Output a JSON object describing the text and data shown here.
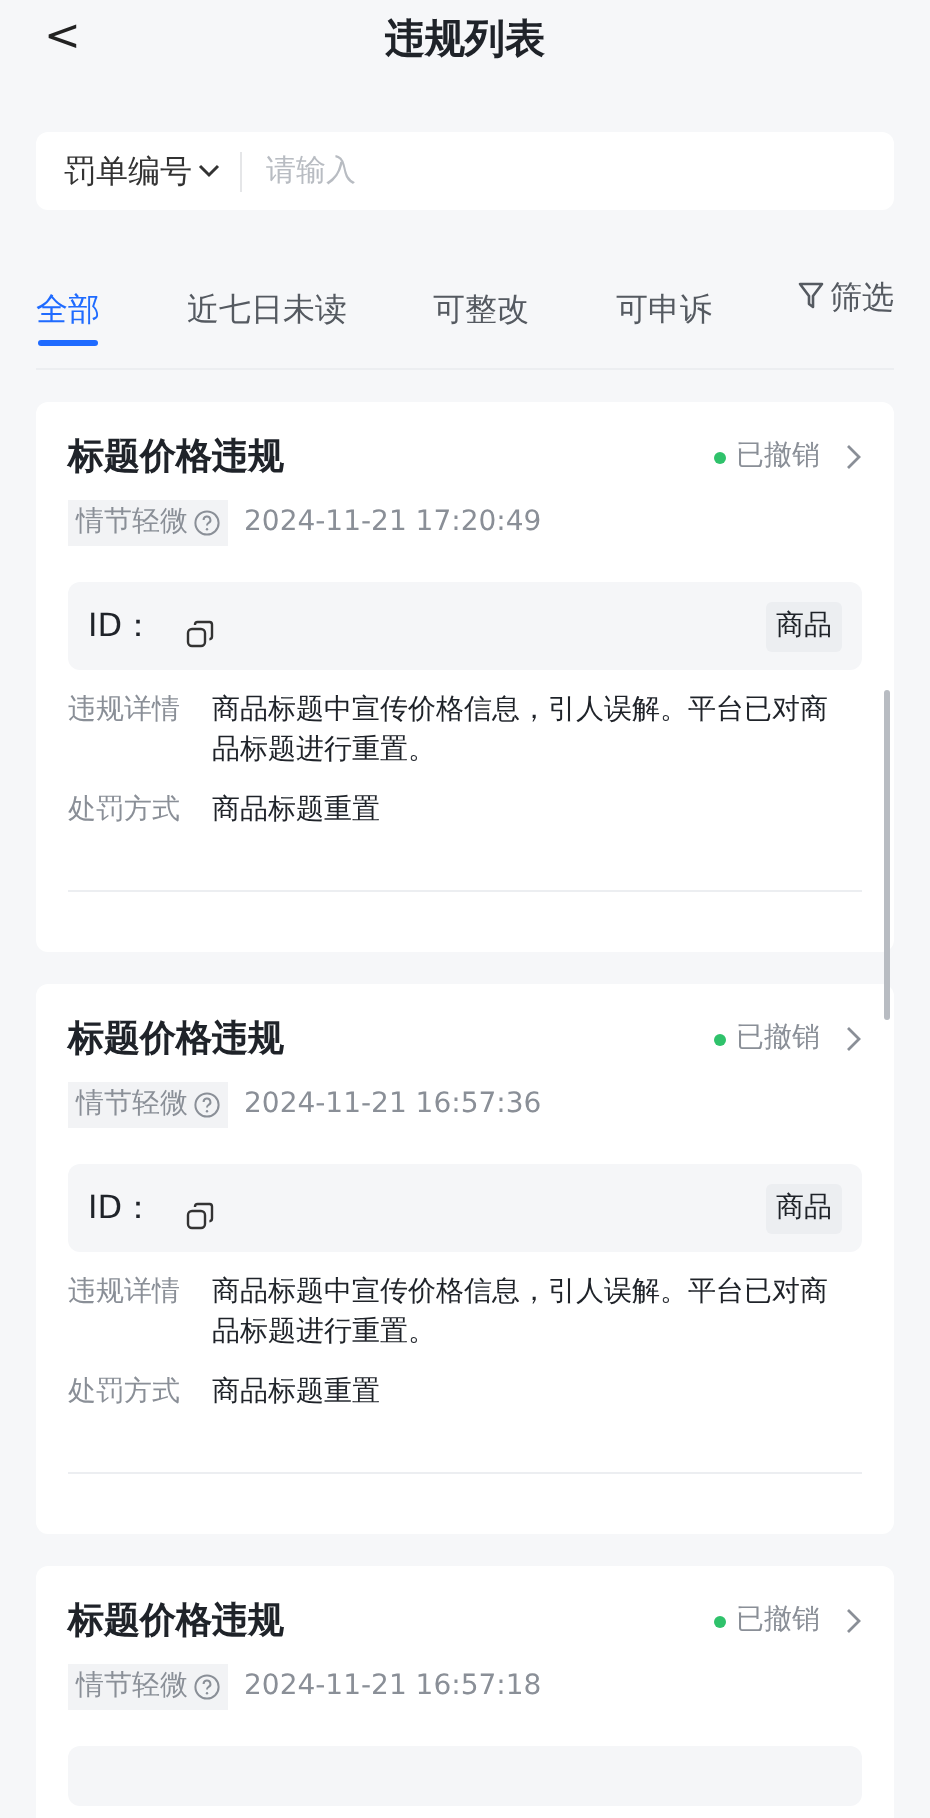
{
  "header": {
    "back": "<",
    "title": "违规列表"
  },
  "search": {
    "field_type": "罚单编号",
    "placeholder": "请输入"
  },
  "tabs": [
    {
      "label": "全部",
      "selected": true
    },
    {
      "label": "近七日未读",
      "selected": false
    },
    {
      "label": "可整改",
      "selected": false
    },
    {
      "label": "可申诉",
      "selected": false
    }
  ],
  "filter": "筛选",
  "records": [
    {
      "title": "标题价格违规",
      "status": "已撤销",
      "color": "#2fc26b",
      "severity": "情节轻微",
      "time": "2024-11-21 17:20:49",
      "id_label": "ID：",
      "type_tag": "商品",
      "details": [
        {
          "label": "违规详情",
          "value": "商品标题中宣传价格信息，引人误解。平台已对商品标题进行重置。"
        },
        {
          "label": "处罚方式",
          "value": "商品标题重置"
        }
      ]
    },
    {
      "title": "标题价格违规",
      "status": "已撤销",
      "color": "#2fc26b",
      "severity": "情节轻微",
      "time": "2024-11-21 16:57:36",
      "id_label": "ID：",
      "type_tag": "商品",
      "details": [
        {
          "label": "违规详情",
          "value": "商品标题中宣传价格信息，引人误解。平台已对商品标题进行重置。"
        },
        {
          "label": "处罚方式",
          "value": "商品标题重置"
        }
      ]
    },
    {
      "title": "标题价格违规",
      "status": "已撤销",
      "color": "#2fc26b",
      "severity": "情节轻微",
      "time": "2024-11-21 16:57:18"
    }
  ]
}
